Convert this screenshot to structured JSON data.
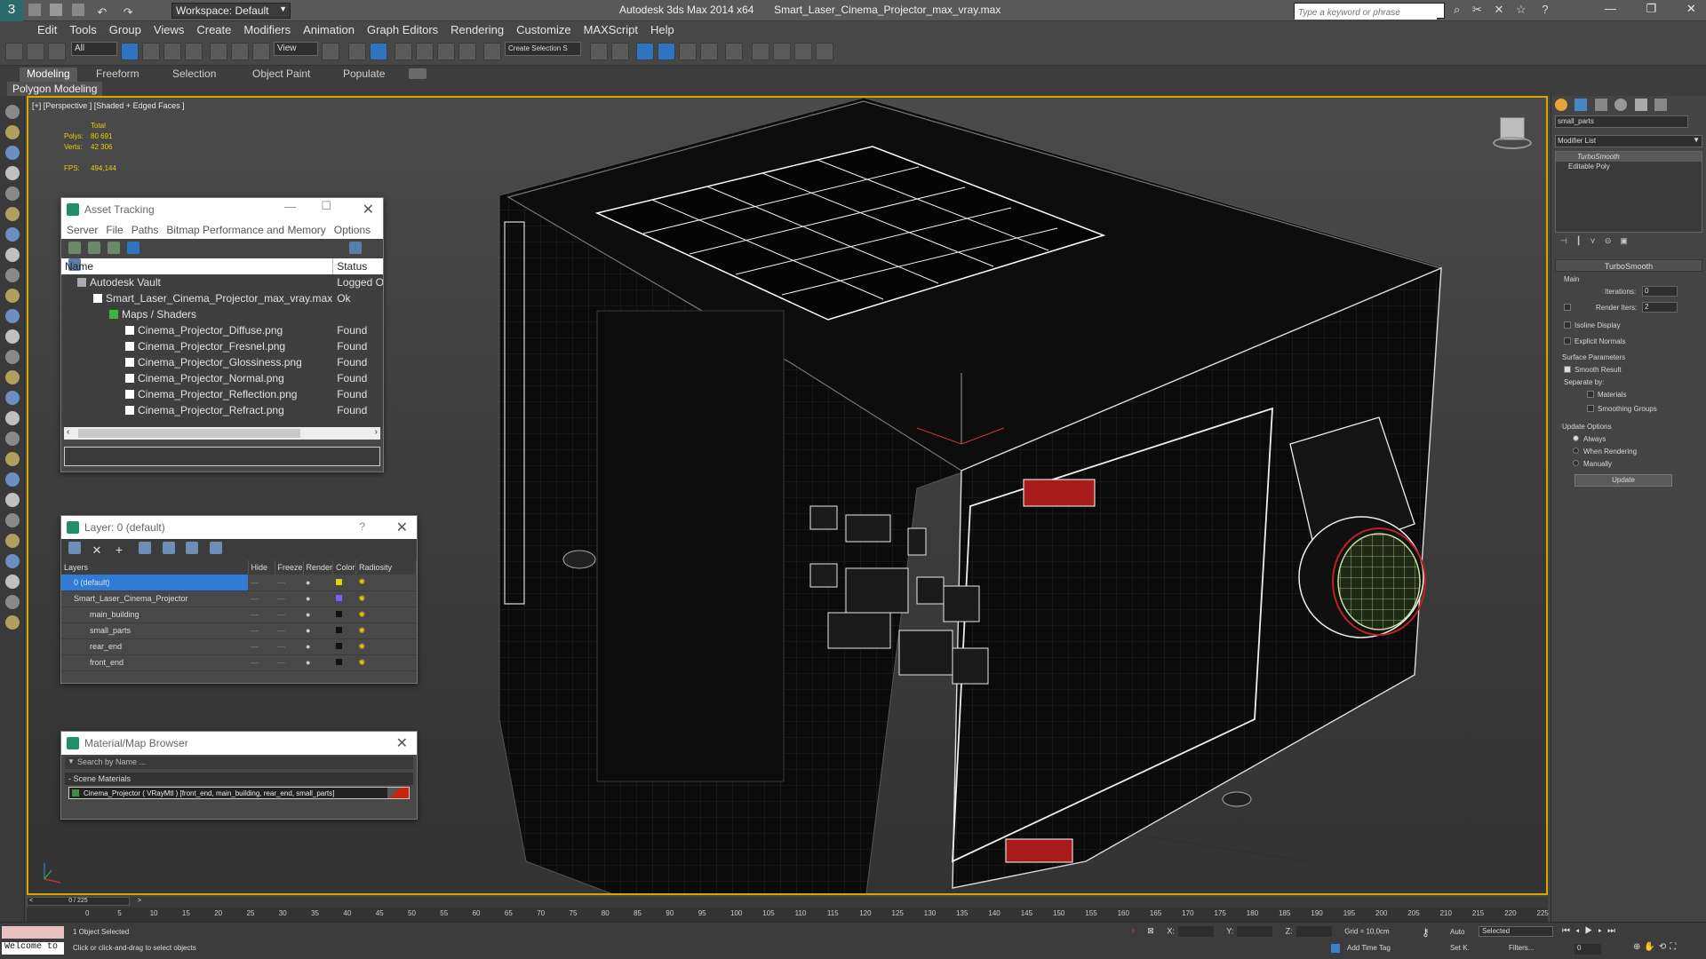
{
  "app": {
    "title": "Autodesk 3ds Max  2014 x64",
    "file": "Smart_Laser_Cinema_Projector_max_vray.max",
    "workspace": "Workspace: Default",
    "search_placeholder": "Type a keyword or phrase"
  },
  "menu": [
    "Edit",
    "Tools",
    "Group",
    "Views",
    "Create",
    "Modifiers",
    "Animation",
    "Graph Editors",
    "Rendering",
    "Customize",
    "MAXScript",
    "Help"
  ],
  "toolbar": {
    "filter": "All",
    "view": "View",
    "selection_set": "Create Selection S"
  },
  "ribbon": {
    "tabs": [
      "Modeling",
      "Freeform",
      "Selection",
      "Object Paint",
      "Populate"
    ],
    "active": "Modeling",
    "sub": "Polygon Modeling"
  },
  "viewport": {
    "label": "[+] [Perspective ] [Shaded + Edged Faces ]",
    "stats": {
      "total": "Total",
      "polys_label": "Polys:",
      "polys": "80 691",
      "verts_label": "Verts:",
      "verts": "42 306",
      "fps_label": "FPS:",
      "fps": "494,144"
    }
  },
  "asset_tracking": {
    "title": "Asset Tracking",
    "menu": [
      "Server",
      "File",
      "Paths",
      "Bitmap Performance and Memory",
      "Options"
    ],
    "columns": [
      "Name",
      "Status"
    ],
    "rows": [
      {
        "name": "Autodesk Vault",
        "status": "Logged O..."
      },
      {
        "name": "Smart_Laser_Cinema_Projector_max_vray.max",
        "status": "Ok"
      },
      {
        "name": "Maps / Shaders",
        "status": ""
      },
      {
        "name": "Cinema_Projector_Diffuse.png",
        "status": "Found"
      },
      {
        "name": "Cinema_Projector_Fresnel.png",
        "status": "Found"
      },
      {
        "name": "Cinema_Projector_Glossiness.png",
        "status": "Found"
      },
      {
        "name": "Cinema_Projector_Normal.png",
        "status": "Found"
      },
      {
        "name": "Cinema_Projector_Reflection.png",
        "status": "Found"
      },
      {
        "name": "Cinema_Projector_Refract.png",
        "status": "Found"
      }
    ]
  },
  "layers": {
    "title": "Layer: 0 (default)",
    "columns": [
      "Layers",
      "Hide",
      "Freeze",
      "Render",
      "Color",
      "Radiosity"
    ],
    "rows": [
      {
        "name": "0 (default)",
        "color": "#e6d200"
      },
      {
        "name": "Smart_Laser_Cinema_Projector",
        "color": "#7a5cff"
      },
      {
        "name": "main_building",
        "color": "#111111"
      },
      {
        "name": "small_parts",
        "color": "#111111"
      },
      {
        "name": "rear_end",
        "color": "#111111"
      },
      {
        "name": "front_end",
        "color": "#111111"
      }
    ]
  },
  "material_browser": {
    "title": "Material/Map Browser",
    "search": "Search by Name ...",
    "section": "- Scene Materials",
    "item": "Cinema_Projector  ( VRayMtl ) [front_end, main_building, rear_end, small_parts]"
  },
  "command_panel": {
    "object_name": "small_parts",
    "modifier_list": "Modifier List",
    "stack": [
      "TurboSmooth",
      "Editable Poly"
    ],
    "rollout": "TurboSmooth",
    "main": "Main",
    "iterations_label": "Iterations:",
    "iterations": "0",
    "render_iters_label": "Render Iters:",
    "render_iters": "2",
    "isoline": "Isoline Display",
    "explicit": "Explicit Normals",
    "surface": "Surface Parameters",
    "smooth": "Smooth Result",
    "separate": "Separate by:",
    "materials": "Materials",
    "smoothing": "Smoothing Groups",
    "update_options": "Update Options",
    "always": "Always",
    "when_rendering": "When Rendering",
    "manually": "Manually",
    "update": "Update"
  },
  "timeline": {
    "frame": "0 / 225",
    "ticks": [
      "0",
      "5",
      "10",
      "15",
      "20",
      "25",
      "30",
      "35",
      "40",
      "45",
      "50",
      "55",
      "60",
      "65",
      "70",
      "75",
      "80",
      "85",
      "90",
      "95",
      "100",
      "105",
      "110",
      "115",
      "120",
      "125",
      "130",
      "135",
      "140",
      "145",
      "150",
      "155",
      "160",
      "165",
      "170",
      "175",
      "180",
      "185",
      "190",
      "195",
      "200",
      "205",
      "210",
      "215",
      "220",
      "225"
    ]
  },
  "status": {
    "welcome": "Welcome to",
    "selected": "1 Object Selected",
    "prompt": "Click or click-and-drag to select objects",
    "x": "X:",
    "y": "Y:",
    "z": "Z:",
    "grid": "Grid = 10,0cm",
    "auto": "Auto",
    "setk": "Set K.",
    "sel_mode": "Selected",
    "filters": "Filters...",
    "time_tag": "Add Time Tag",
    "frame": "0"
  }
}
